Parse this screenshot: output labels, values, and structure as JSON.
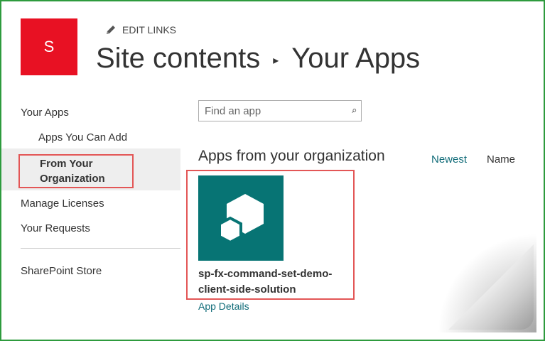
{
  "site": {
    "logo_letter": "S",
    "logo_color": "#e81123",
    "edit_links_label": "EDIT LINKS",
    "title_part1": "Site contents",
    "title_separator": "▸",
    "title_part2": "Your Apps"
  },
  "nav": {
    "items": [
      {
        "label": "Your Apps"
      },
      {
        "label": "Apps You Can Add"
      },
      {
        "label": "From Your Organization",
        "selected": true
      },
      {
        "label": "Manage Licenses"
      },
      {
        "label": "Your Requests"
      },
      {
        "label": "SharePoint Store"
      }
    ]
  },
  "search": {
    "placeholder": "Find an app",
    "value": ""
  },
  "main": {
    "section_title": "Apps from your organization",
    "sort_newest": "Newest",
    "sort_name": "Name",
    "accent_color": "#0f6b78",
    "apps": [
      {
        "name": "sp-fx-command-set-demo-client-side-solution",
        "details_link": "App Details",
        "icon": "spfx-cubes-icon",
        "tile_color": "#077474"
      }
    ]
  },
  "highlight_color": "#e35656"
}
